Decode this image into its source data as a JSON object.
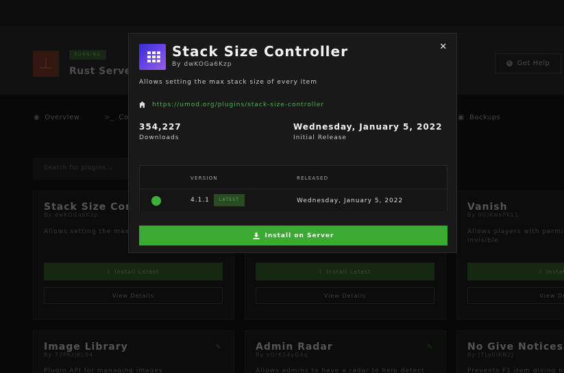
{
  "server": {
    "badge": "RUNNING",
    "name": "Rust Server",
    "get_help": "Get Help"
  },
  "tabs": [
    "Overview",
    "Co",
    "Backups"
  ],
  "search": {
    "placeholder": "Search for plugins..."
  },
  "cards": [
    {
      "title": "Stack Size Contr",
      "by": "By dwKOGa6Kzp",
      "desc": "Allows setting the max",
      "install": "Install Latest",
      "view": "View Details"
    },
    {
      "title": "",
      "by": "",
      "desc": "",
      "install": "Install Latest",
      "view": "View Details"
    },
    {
      "title": "Vanish",
      "by": "By 0GjKwkPKL1",
      "desc": "Allows players with permis",
      "desc2": "invisible",
      "install": "Install",
      "view": "View De"
    },
    {
      "title": "Image Library",
      "by": "By 72PKzjKL94",
      "desc": "Plugin API for managing images"
    },
    {
      "title": "Admin Radar",
      "by": "By kOrK14yG4q",
      "desc": "Allows admins to have a radar to help detect"
    },
    {
      "title": "No Give Notices",
      "by": "By J7Ly0IKN2J",
      "desc": "Prevents F1 item giving no"
    }
  ],
  "modal": {
    "title": "Stack Size Controller",
    "author": "By dwKOGa6Kzp",
    "description": "Allows setting the max stack size of every item",
    "link": "https://umod.org/plugins/stack-size-controller",
    "downloads_value": "354,227",
    "downloads_label": "Downloads",
    "release_value": "Wednesday, January 5, 2022",
    "release_label": "Initial Release",
    "table": {
      "col_version": "VERSION",
      "col_released": "RELEASED",
      "rows": [
        {
          "version": "4.1.1",
          "badge": "LATEST",
          "released": "Wednesday, January 5, 2022",
          "status_color": "#3db03a"
        }
      ]
    },
    "install_button": "Install on Server"
  },
  "colors": {
    "accent": "#3aaa33",
    "link": "#4ab84a"
  }
}
